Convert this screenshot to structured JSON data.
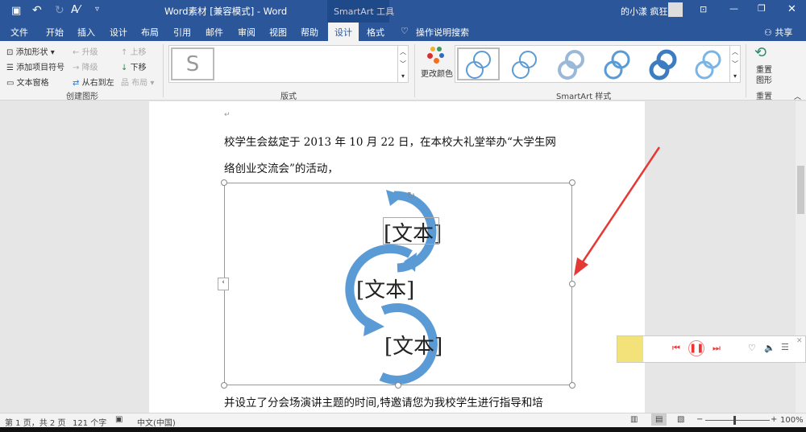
{
  "titlebar": {
    "title": "Word素材 [兼容模式] - Word",
    "context_tab": "SmartArt 工具",
    "user": "的小漾 疯狂"
  },
  "tabs": [
    "文件",
    "开始",
    "插入",
    "设计",
    "布局",
    "引用",
    "邮件",
    "审阅",
    "视图",
    "帮助",
    "设计",
    "格式"
  ],
  "search": "操作说明搜索",
  "share": "共享",
  "ribbon": {
    "create": {
      "add_shape": "添加形状",
      "add_bullet": "添加项目符号",
      "text_pane": "文本窗格",
      "promote": "升级",
      "demote": "降级",
      "rtl": "从右到左",
      "move_up": "上移",
      "move_down": "下移",
      "layout": "布局",
      "group": "创建图形"
    },
    "layouts_group": "版式",
    "change_colors": "更改颜色",
    "styles_group": "SmartArt 样式",
    "reset_graphic": "重置\n图形",
    "reset_group": "重置"
  },
  "document": {
    "line1": "校学生会兹定于 2013 年 10 月 22 日，在本校大礼堂举办“大学生网",
    "line2": "络创业交流会”的活动，",
    "line3": "并设立了分会场演讲主题的时间,特邀请您为我校学生进行指导和培",
    "smartart_texts": [
      "[文本]",
      "[文本]",
      "[文本]"
    ]
  },
  "status": {
    "page": "第 1 页，共 2 页",
    "words": "121 个字",
    "lang": "中文(中国)",
    "zoom": "100%"
  },
  "colors": {
    "brand": "#2b579a",
    "smartart": "#5b9bd5",
    "arrow": "#e53935"
  }
}
